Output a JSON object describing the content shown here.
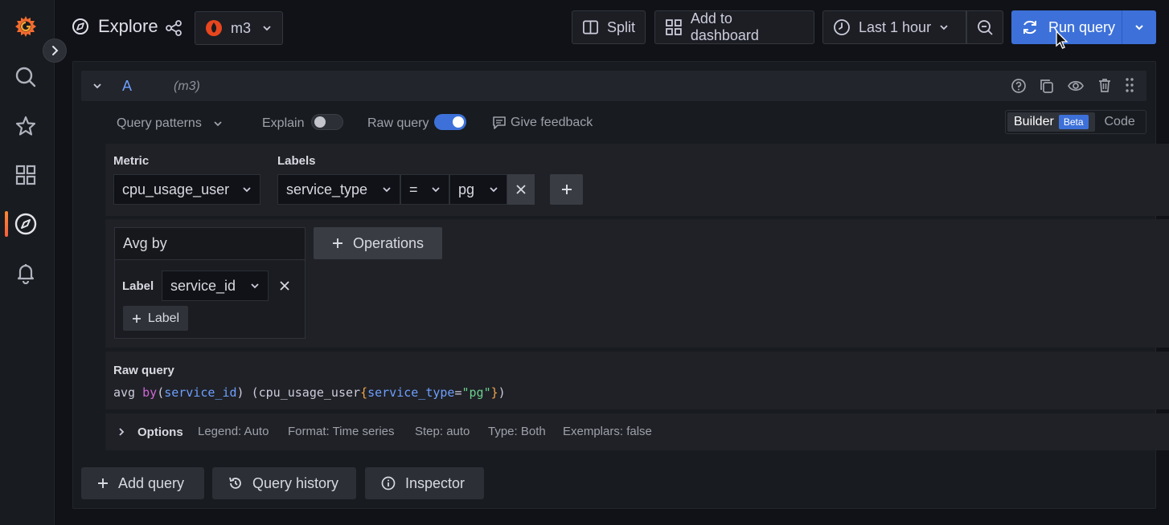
{
  "header": {
    "title": "Explore",
    "datasource": "m3",
    "split_label": "Split",
    "add_dashboard_label": "Add to dashboard",
    "time_range": "Last 1 hour",
    "run_query_label": "Run query"
  },
  "query": {
    "ref_id": "A",
    "datasource_hint": "(m3)",
    "patterns_label": "Query patterns",
    "explain_label": "Explain",
    "raw_query_label": "Raw query",
    "feedback_label": "Give feedback",
    "builder_label": "Builder",
    "beta_label": "Beta",
    "code_label": "Code"
  },
  "metric": {
    "label": "Metric",
    "value": "cpu_usage_user"
  },
  "labels": {
    "label": "Labels",
    "key": "service_type",
    "operator": "=",
    "value": "pg"
  },
  "operation": {
    "title": "Avg by",
    "label_text": "Label",
    "label_value": "service_id",
    "add_label": "Label",
    "operations_label": "Operations"
  },
  "raw": {
    "title": "Raw query",
    "p1": "avg ",
    "p2": "by",
    "p3": "(",
    "p4": "service_id",
    "p5": ") (",
    "p6": "cpu_usage_user",
    "p7": "{",
    "p8": "service_type",
    "p9": "=",
    "p10": "\"pg\"",
    "p11": "}",
    "p12": ")"
  },
  "options": {
    "label": "Options",
    "legend": "Legend: Auto",
    "format": "Format: Time series",
    "step": "Step: auto",
    "type": "Type: Both",
    "exemplars": "Exemplars: false"
  },
  "footer": {
    "add_query": "Add query",
    "query_history": "Query history",
    "inspector": "Inspector"
  },
  "colors": {
    "accent": "#3d71d9",
    "brand_orange": "#f55f3e",
    "syntax_keyword": "#d066d8",
    "syntax_label": "#6e9fff",
    "syntax_string": "#6ccf8e",
    "syntax_brace": "#f2a44c"
  }
}
